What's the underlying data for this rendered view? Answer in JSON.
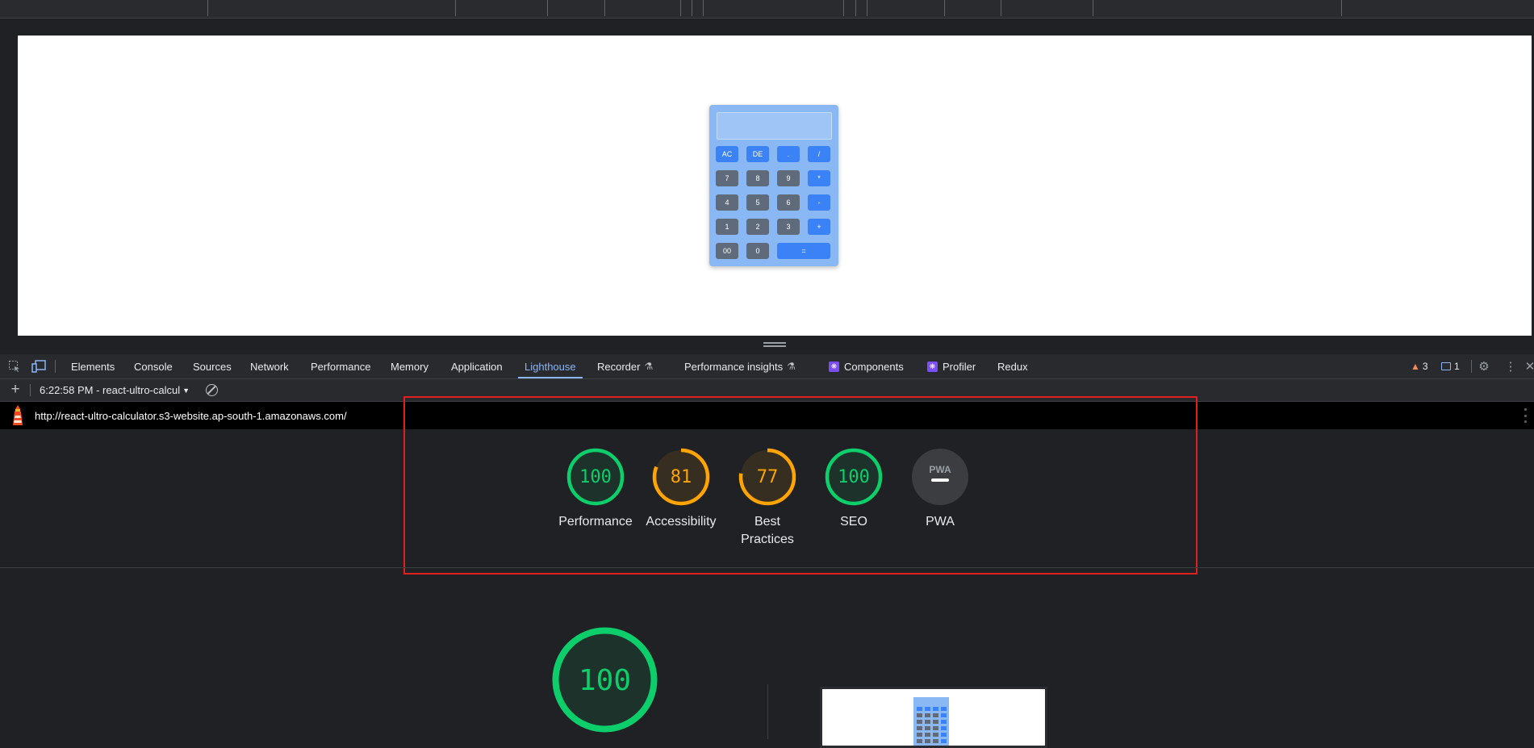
{
  "calculator": {
    "rows": [
      [
        {
          "label": "AC",
          "kind": "op"
        },
        {
          "label": "DE",
          "kind": "op"
        },
        {
          "label": ".",
          "kind": "op"
        },
        {
          "label": "/",
          "kind": "op"
        }
      ],
      [
        {
          "label": "7",
          "kind": "num"
        },
        {
          "label": "8",
          "kind": "num"
        },
        {
          "label": "9",
          "kind": "num"
        },
        {
          "label": "*",
          "kind": "op"
        }
      ],
      [
        {
          "label": "4",
          "kind": "num"
        },
        {
          "label": "5",
          "kind": "num"
        },
        {
          "label": "6",
          "kind": "num"
        },
        {
          "label": "-",
          "kind": "op"
        }
      ],
      [
        {
          "label": "1",
          "kind": "num"
        },
        {
          "label": "2",
          "kind": "num"
        },
        {
          "label": "3",
          "kind": "num"
        },
        {
          "label": "+",
          "kind": "op"
        }
      ],
      [
        {
          "label": "00",
          "kind": "num"
        },
        {
          "label": "0",
          "kind": "num"
        },
        {
          "label": "=",
          "kind": "op"
        }
      ]
    ]
  },
  "devtools": {
    "tabs": {
      "elements": "Elements",
      "console": "Console",
      "sources": "Sources",
      "network": "Network",
      "performance": "Performance",
      "memory": "Memory",
      "application": "Application",
      "lighthouse": "Lighthouse",
      "recorder": "Recorder",
      "performance_insights": "Performance insights",
      "components": "Components",
      "profiler": "Profiler",
      "redux": "Redux"
    },
    "active_tab": "Lighthouse",
    "warnings_count": "3",
    "messages_count": "1"
  },
  "lighthouse": {
    "report_selector": "6:22:58 PM - react-ultro-calcul",
    "url": "http://react-ultro-calculator.s3-website.ap-south-1.amazonaws.com/",
    "scores": [
      {
        "value": "100",
        "label": "Performance",
        "score": 1.0,
        "color": "#0cce6b"
      },
      {
        "value": "81",
        "label": "Accessibility",
        "score": 0.81,
        "color": "#ffa400"
      },
      {
        "value": "77",
        "label": "Best Practices",
        "score": 0.77,
        "color": "#ffa400"
      },
      {
        "value": "100",
        "label": "SEO",
        "score": 1.0,
        "color": "#0cce6b"
      },
      {
        "value": "",
        "label": "PWA",
        "score": null,
        "color": "#9aa0a6",
        "badge": "PWA"
      }
    ],
    "main_score": {
      "value": "100",
      "score": 1.0,
      "color": "#0cce6b"
    }
  },
  "colors": {
    "pass": "#0cce6b",
    "average": "#ffa400",
    "accent": "#8ab4f8",
    "highlight": "#e01f1f"
  }
}
